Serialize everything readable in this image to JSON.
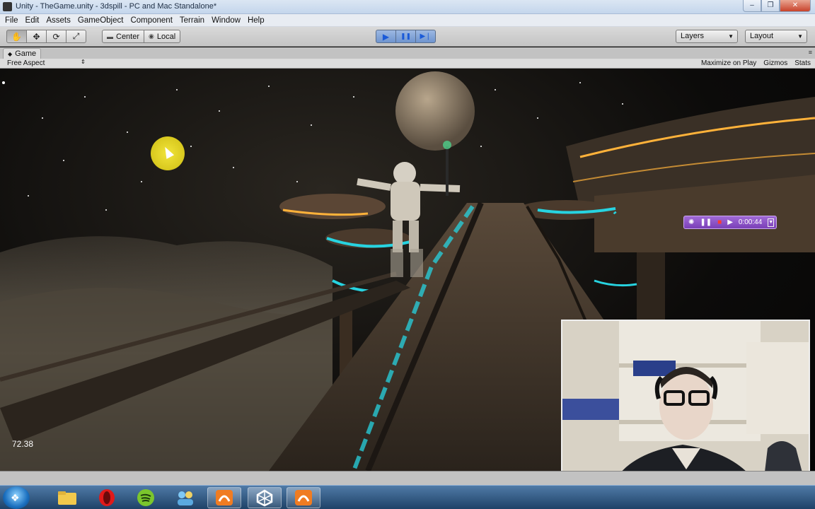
{
  "window": {
    "title": "Unity - TheGame.unity - 3dspill - PC and Mac Standalone*",
    "min_glyph": "–",
    "max_glyph": "❐",
    "close_glyph": "✕"
  },
  "menu": [
    "File",
    "Edit",
    "Assets",
    "GameObject",
    "Component",
    "Terrain",
    "Window",
    "Help"
  ],
  "toolbar": {
    "tools": [
      "hand-icon",
      "move-icon",
      "rotate-icon",
      "scale-icon"
    ],
    "tool_glyphs": [
      "✋",
      "✥",
      "⟳",
      "⤢"
    ],
    "pivot_label": "Center",
    "space_label": "Local",
    "play_glyph": "▶",
    "pause_glyph": "❚❚",
    "step_glyph": "▶❘",
    "layers_label": "Layers",
    "layout_label": "Layout"
  },
  "game_tab": {
    "label": "Game",
    "aspect": "Free Aspect",
    "maximize_on_play": "Maximize on Play",
    "gizmos": "Gizmos",
    "stats": "Stats"
  },
  "fps": "72.38",
  "recorder": {
    "time": "0:00:44"
  },
  "taskbar": {
    "apps": [
      "folder-icon",
      "opera-icon",
      "spotify-icon",
      "people-icon",
      "app-orange-icon",
      "unity-icon",
      "app-orange-icon-2"
    ]
  },
  "colors": {
    "play_accent": "#1a5ad8",
    "recorder": "#7a3fb8",
    "glow_cyan": "#27d3e0",
    "glow_orange": "#ffb23a"
  }
}
